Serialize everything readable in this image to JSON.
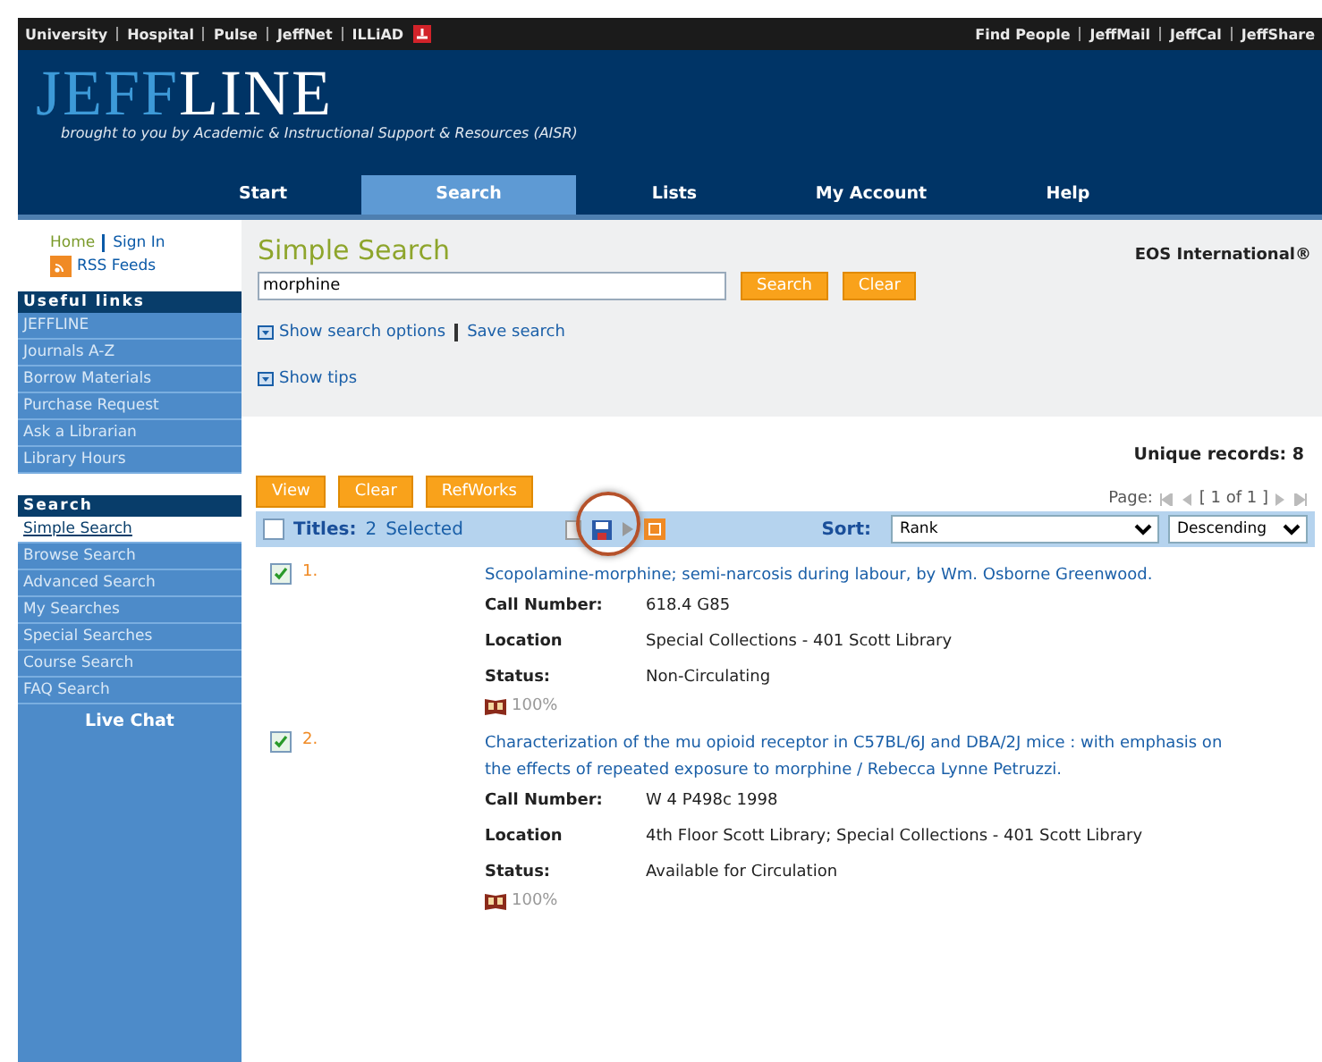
{
  "top_bar": {
    "left_links": [
      "University",
      "Hospital",
      "Pulse",
      "JeffNet",
      "ILLiAD"
    ],
    "right_links": [
      "Find People",
      "JeffMail",
      "JeffCal",
      "JeffShare"
    ]
  },
  "header": {
    "logo_first": "JEFF",
    "logo_second": "LINE",
    "tagline": "brought to you by Academic & Instructional Support & Resources (AISR)"
  },
  "nav_tabs": [
    {
      "label": "Start",
      "selected": false
    },
    {
      "label": "Search",
      "selected": true
    },
    {
      "label": "Lists",
      "selected": false
    },
    {
      "label": "My Account",
      "selected": false
    },
    {
      "label": "Help",
      "selected": false
    }
  ],
  "sidebar": {
    "home": "Home",
    "sign_in": "Sign In",
    "rss": "RSS Feeds",
    "sections": [
      {
        "title": "Useful links",
        "items": [
          {
            "label": "JEFFLINE",
            "selected": false
          },
          {
            "label": "Journals A-Z",
            "selected": false
          },
          {
            "label": "Borrow Materials",
            "selected": false
          },
          {
            "label": "Purchase Request",
            "selected": false
          },
          {
            "label": "Ask a Librarian",
            "selected": false
          },
          {
            "label": "Library Hours",
            "selected": false
          }
        ]
      },
      {
        "title": "Search",
        "items": [
          {
            "label": "Simple Search",
            "selected": true
          },
          {
            "label": "Browse Search",
            "selected": false
          },
          {
            "label": "Advanced Search",
            "selected": false
          },
          {
            "label": "My Searches",
            "selected": false
          },
          {
            "label": "Special Searches",
            "selected": false
          },
          {
            "label": "Course Search",
            "selected": false
          },
          {
            "label": "FAQ Search",
            "selected": false
          }
        ]
      }
    ],
    "live_chat": "Live Chat"
  },
  "search": {
    "title": "Simple Search",
    "vendor": "EOS International®",
    "value": "morphine",
    "buttons": [
      "Search",
      "Clear"
    ],
    "options_link": "Show search options",
    "save_link": "Save search",
    "tips_link": "Show tips"
  },
  "results": {
    "unique_records": "Unique records: 8",
    "buttons": [
      "View",
      "Clear",
      "RefWorks"
    ],
    "page_label": "Page:",
    "page_range": "[ 1 of 1 ]",
    "all_checked": false,
    "titles_label": "Titles:",
    "selected_count": "2",
    "selected_label": "Selected",
    "sort_label": "Sort:",
    "sort_by": "Rank",
    "sort_order": "Descending",
    "records": [
      {
        "checked": true,
        "number": "1.",
        "title": "Scopolamine-morphine; semi-narcosis during labour, by Wm. Osborne Greenwood.",
        "fields": [
          {
            "label": "Call Number:",
            "value": "618.4 G85"
          },
          {
            "label": "Location",
            "value": "Special Collections - 401 Scott Library"
          },
          {
            "label": "Status:",
            "value": "Non-Circulating"
          }
        ],
        "availability": "100%"
      },
      {
        "checked": true,
        "number": "2.",
        "title": "Characterization of the mu opioid receptor in C57BL/6J and DBA/2J mice : with emphasis on the effects of repeated exposure to morphine / Rebecca Lynne Petruzzi.",
        "fields": [
          {
            "label": "Call Number:",
            "value": "W 4 P498c 1998"
          },
          {
            "label": "Location",
            "value": "4th Floor Scott Library; Special Collections - 401 Scott Library"
          },
          {
            "label": "Status:",
            "value": "Available for Circulation"
          }
        ],
        "availability": "100%"
      }
    ]
  }
}
